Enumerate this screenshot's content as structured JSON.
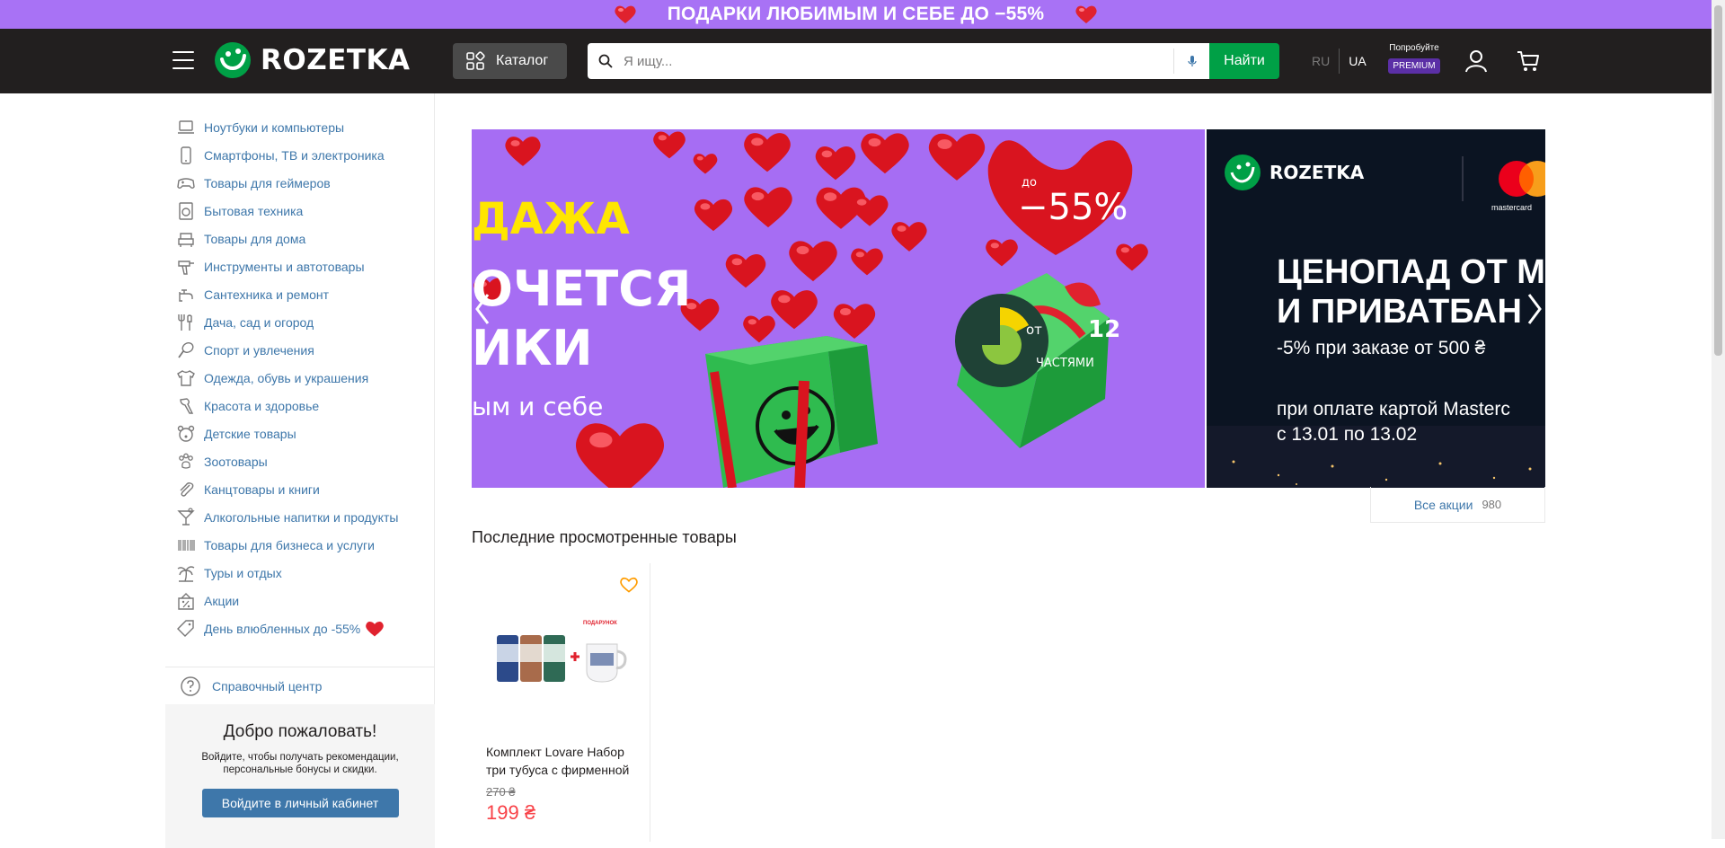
{
  "promo_bar": {
    "text": "ПОДАРКИ ЛЮБИМЫМ И СЕБЕ ДО −55%"
  },
  "header": {
    "logo_text": "ROZETKA",
    "catalog_label": "Каталог",
    "search_placeholder": "Я ищу...",
    "search_button": "Найти",
    "lang_ru": "RU",
    "lang_ua": "UA",
    "premium_try": "Попробуйте",
    "premium_badge": "PREMIUM"
  },
  "sidebar": {
    "categories": [
      {
        "label": "Ноутбуки и компьютеры",
        "icon": "laptop-icon"
      },
      {
        "label": "Смартфоны, ТВ и электроника",
        "icon": "smartphone-icon"
      },
      {
        "label": "Товары для геймеров",
        "icon": "gamepad-icon"
      },
      {
        "label": "Бытовая техника",
        "icon": "washing-machine-icon"
      },
      {
        "label": "Товары для дома",
        "icon": "armchair-icon"
      },
      {
        "label": "Инструменты и автотовары",
        "icon": "drill-icon"
      },
      {
        "label": "Сантехника и ремонт",
        "icon": "faucet-icon"
      },
      {
        "label": "Дача, сад и огород",
        "icon": "garden-tools-icon"
      },
      {
        "label": "Спорт и увлечения",
        "icon": "sport-icon"
      },
      {
        "label": "Одежда, обувь и украшения",
        "icon": "tshirt-icon"
      },
      {
        "label": "Красота и здоровье",
        "icon": "beauty-icon"
      },
      {
        "label": "Детские товары",
        "icon": "teddy-bear-icon"
      },
      {
        "label": "Зоотовары",
        "icon": "paw-icon"
      },
      {
        "label": "Канцтовары и книги",
        "icon": "paperclip-icon"
      },
      {
        "label": "Алкогольные напитки и продукты",
        "icon": "cocktail-icon"
      },
      {
        "label": "Товары для бизнеса и услуги",
        "icon": "barcode-icon"
      },
      {
        "label": "Туры и отдых",
        "icon": "palm-tree-icon"
      },
      {
        "label": "Акции",
        "icon": "percent-icon"
      },
      {
        "label": "День влюбленных до -55%",
        "icon": "tag-icon"
      }
    ],
    "help_label": "Справочный центр",
    "welcome_title": "Добро пожаловать!",
    "welcome_text": "Войдите, чтобы получать рекомендации, персональные бонусы и скидки.",
    "login_button": "Войдите в личный кабинет"
  },
  "banner": {
    "slide1": {
      "line1": "ДАЖА",
      "line2": "ОЧЕТСЯ",
      "line3": "ИКИ",
      "line4": "ым и себе",
      "discount_prefix": "до",
      "discount": "−55%",
      "installment_from": "от",
      "installment_num": "12",
      "installment_label": "ЧАСТЯМИ"
    },
    "slide2": {
      "logo": "ROZETKA",
      "partner": "mastercard",
      "title1": "ЦЕНОПАД ОТ М",
      "title2": "И ПРИВАТБАН",
      "sub": "-5% при заказе от 500 ₴",
      "note1": "при оплате картой Masterc",
      "note2": "с 13.01 по 13.02"
    }
  },
  "all_promotions": {
    "label": "Все акции",
    "count": "980"
  },
  "recent": {
    "title": "Последние просмотренные товары",
    "products": [
      {
        "title": "Комплект Lovare Набор три тубуса с фирменной",
        "old_price": "270 ₴",
        "price": "199 ₴",
        "gift_label": "ПОДАРУНОК"
      }
    ]
  },
  "colors": {
    "accent_green": "#00a046",
    "header_bg": "#221f1f",
    "promo_purple": "#a872f5",
    "link_blue": "#3e77aa",
    "price_red": "#f84147"
  }
}
